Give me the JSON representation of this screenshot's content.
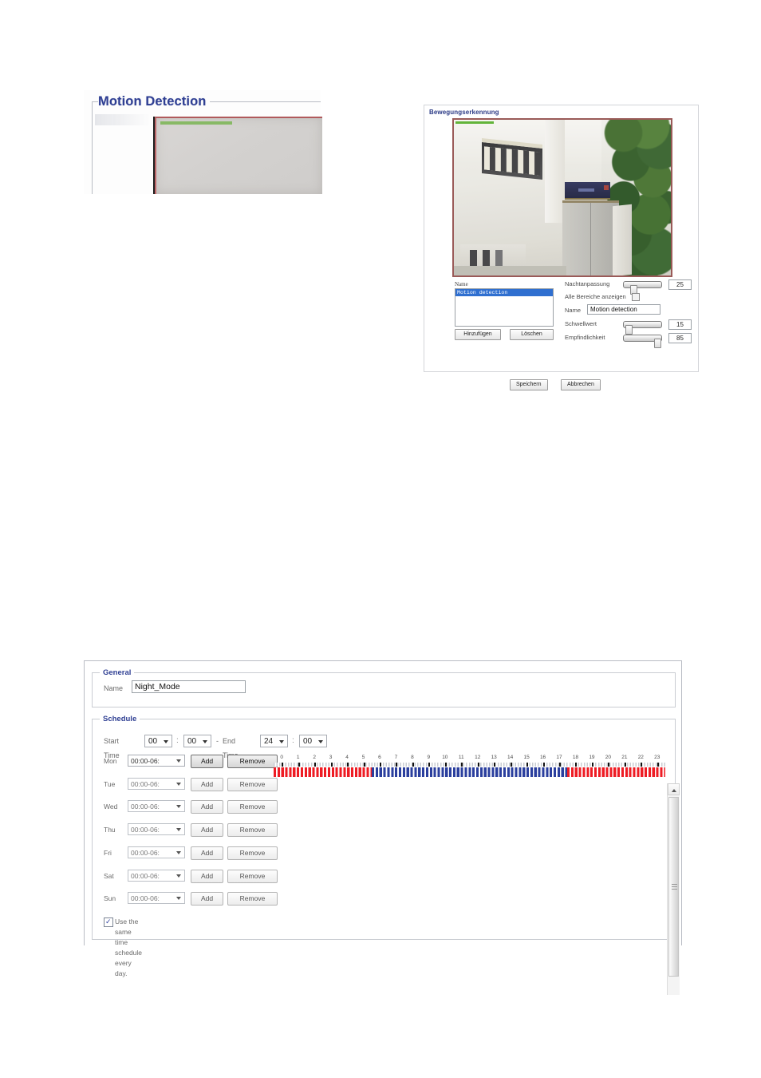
{
  "motion_detection_fragment": {
    "legend": "Motion Detection",
    "preview_alt": "camera-preview"
  },
  "german_panel": {
    "title": "Bewegungserkennung",
    "video_alt": "live-camera-view",
    "name_list_label": "Name",
    "list_items": [
      "Motion detection"
    ],
    "selected_item": "Motion detection",
    "buttons": {
      "add": "Hinzufügen",
      "delete": "Löschen"
    },
    "controls": [
      {
        "label": "Nachtanpassung",
        "value": "25",
        "percent": 25
      },
      {
        "label": "Schwellwert",
        "value": "15",
        "percent": 8
      },
      {
        "label": "Empfindlichkeit",
        "value": "85",
        "percent": 88
      }
    ],
    "show_all_areas_label": "Alle Bereiche anzeigen",
    "show_all_areas_checked": false,
    "name_field_label": "Name",
    "name_field_value": "Motion detection",
    "footer_buttons": {
      "save": "Speichern",
      "cancel": "Abbrechen"
    }
  },
  "schedule_page": {
    "general": {
      "legend": "General",
      "name_label": "Name",
      "name_value": "Night_Mode"
    },
    "schedule": {
      "legend": "Schedule",
      "start_time_label": "Start Time",
      "start_hour": "00",
      "start_minute": "00",
      "separator": "-",
      "end_time_label": "End Time",
      "end_hour": "24",
      "end_minute": "00",
      "colon": ":",
      "days": [
        {
          "day": "Mon",
          "range": "00:00-06:",
          "add": "Add",
          "remove": "Remove",
          "enabled": true
        },
        {
          "day": "Tue",
          "range": "00:00-06:",
          "add": "Add",
          "remove": "Remove",
          "enabled": false
        },
        {
          "day": "Wed",
          "range": "00:00-06:",
          "add": "Add",
          "remove": "Remove",
          "enabled": false
        },
        {
          "day": "Thu",
          "range": "00:00-06:",
          "add": "Add",
          "remove": "Remove",
          "enabled": false
        },
        {
          "day": "Fri",
          "range": "00:00-06:",
          "add": "Add",
          "remove": "Remove",
          "enabled": false
        },
        {
          "day": "Sat",
          "range": "00:00-06:",
          "add": "Add",
          "remove": "Remove",
          "enabled": false
        },
        {
          "day": "Sun",
          "range": "00:00-06:",
          "add": "Add",
          "remove": "Remove",
          "enabled": false
        }
      ],
      "same_schedule_label": "Use the same time schedule every day.",
      "same_schedule_checked": true,
      "timeline": {
        "hour_labels": [
          "0",
          "1",
          "2",
          "3",
          "4",
          "5",
          "6",
          "7",
          "8",
          "9",
          "10",
          "11",
          "12",
          "13",
          "14",
          "15",
          "16",
          "17",
          "18",
          "19",
          "20",
          "21",
          "22",
          "23"
        ],
        "segments": [
          {
            "from_hour": 0,
            "to_hour": 6,
            "color": "#ee1c24",
            "state": "active"
          },
          {
            "from_hour": 6,
            "to_hour": 18,
            "color": "#2b3f9e",
            "state": "inactive"
          },
          {
            "from_hour": 18,
            "to_hour": 24,
            "color": "#ee1c24",
            "state": "active"
          }
        ]
      }
    }
  },
  "colors": {
    "legend_blue": "#2f3f93",
    "timeline_red": "#ee1c24",
    "timeline_blue": "#2b3f9e",
    "selection_blue": "#2f6fd0"
  }
}
